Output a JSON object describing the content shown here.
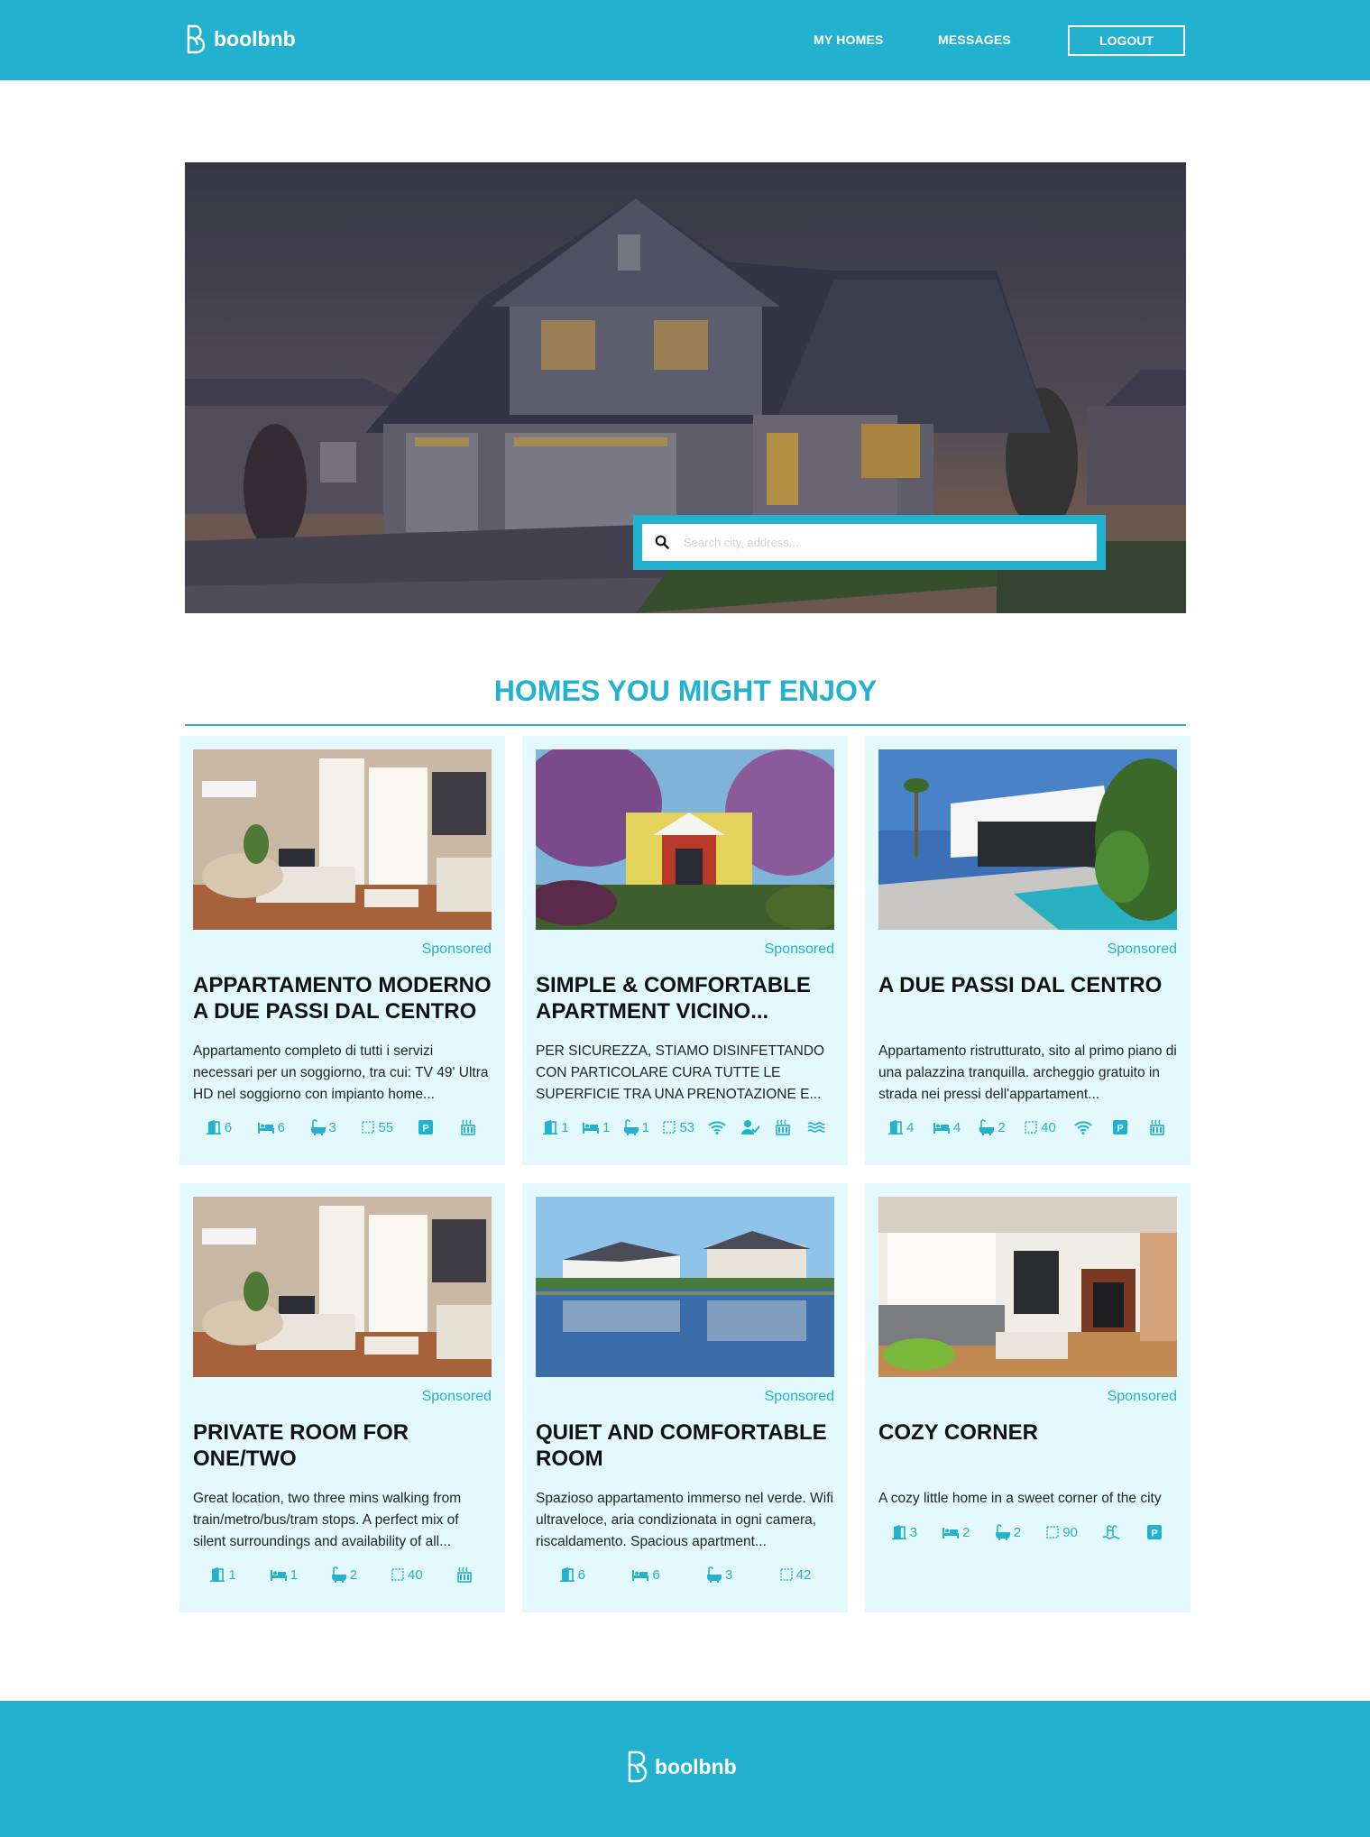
{
  "header": {
    "brand": "boolbnb",
    "nav": {
      "my_homes": "MY HOMES",
      "messages": "MESSAGES",
      "logout": "LOGOUT"
    }
  },
  "search": {
    "placeholder": "Search city, address..."
  },
  "section": {
    "title": "HOMES YOU MIGHT ENJOY"
  },
  "cards": [
    {
      "sponsored": "Sponsored",
      "title": "APPARTAMENTO MODERNO A DUE PASSI DAL CENTRO",
      "description": "Appartamento completo di tutti i servizi necessari per un soggiorno, tra cui: TV 49' Ultra HD nel soggiorno con impianto home...",
      "amenities": [
        {
          "icon": "door-icon",
          "value": "6"
        },
        {
          "icon": "bed-icon",
          "value": "6"
        },
        {
          "icon": "bath-icon",
          "value": "3"
        },
        {
          "icon": "area-icon",
          "value": "55"
        },
        {
          "icon": "parking-icon",
          "value": ""
        },
        {
          "icon": "sauna-icon",
          "value": ""
        }
      ]
    },
    {
      "sponsored": "Sponsored",
      "title": "SIMPLE & COMFORTABLE APARTMENT VICINO...",
      "description": "PER SICUREZZA, STIAMO DISINFETTANDO CON PARTICOLARE CURA TUTTE LE SUPERFICIE TRA UNA PRENOTAZIONE E...",
      "amenities": [
        {
          "icon": "door-icon",
          "value": "1"
        },
        {
          "icon": "bed-icon",
          "value": "1"
        },
        {
          "icon": "bath-icon",
          "value": "1"
        },
        {
          "icon": "area-icon",
          "value": "53"
        },
        {
          "icon": "wifi-icon",
          "value": ""
        },
        {
          "icon": "concierge-icon",
          "value": ""
        },
        {
          "icon": "sauna-icon",
          "value": ""
        },
        {
          "icon": "sea-view-icon",
          "value": ""
        }
      ]
    },
    {
      "sponsored": "Sponsored",
      "title": "A DUE PASSI DAL CENTRO",
      "description": "Appartamento ristrutturato, sito al primo piano di una palazzina tranquilla. archeggio gratuito in strada nei pressi dell'appartament...",
      "amenities": [
        {
          "icon": "door-icon",
          "value": "4"
        },
        {
          "icon": "bed-icon",
          "value": "4"
        },
        {
          "icon": "bath-icon",
          "value": "2"
        },
        {
          "icon": "area-icon",
          "value": "40"
        },
        {
          "icon": "wifi-icon",
          "value": ""
        },
        {
          "icon": "parking-icon",
          "value": ""
        },
        {
          "icon": "sauna-icon",
          "value": ""
        }
      ]
    },
    {
      "sponsored": "Sponsored",
      "title": "PRIVATE ROOM FOR ONE/TWO",
      "description": "Great location, two three mins walking from train/metro/bus/tram stops. A perfect mix of silent surroundings and availability of all...",
      "amenities": [
        {
          "icon": "door-icon",
          "value": "1"
        },
        {
          "icon": "bed-icon",
          "value": "1"
        },
        {
          "icon": "bath-icon",
          "value": "2"
        },
        {
          "icon": "area-icon",
          "value": "40"
        },
        {
          "icon": "sauna-icon",
          "value": ""
        }
      ]
    },
    {
      "sponsored": "Sponsored",
      "title": "QUIET AND COMFORTABLE ROOM",
      "description": "Spazioso appartamento immerso nel verde. Wifi ultraveloce, aria condizionata in ogni camera, riscaldamento. Spacious apartment...",
      "amenities": [
        {
          "icon": "door-icon",
          "value": "6"
        },
        {
          "icon": "bed-icon",
          "value": "6"
        },
        {
          "icon": "bath-icon",
          "value": "3"
        },
        {
          "icon": "area-icon",
          "value": "42"
        }
      ]
    },
    {
      "sponsored": "Sponsored",
      "title": "COZY CORNER",
      "description": "A cozy little home in a sweet corner of the city",
      "amenities": [
        {
          "icon": "door-icon",
          "value": "3"
        },
        {
          "icon": "bed-icon",
          "value": "2"
        },
        {
          "icon": "bath-icon",
          "value": "2"
        },
        {
          "icon": "area-icon",
          "value": "90"
        },
        {
          "icon": "pool-icon",
          "value": ""
        },
        {
          "icon": "parking-icon",
          "value": ""
        }
      ]
    }
  ],
  "footer": {
    "brand": "boolbnb"
  },
  "colors": {
    "accent": "#22b2cf",
    "card_bg": "#e4f9fd",
    "text": "#111111"
  }
}
